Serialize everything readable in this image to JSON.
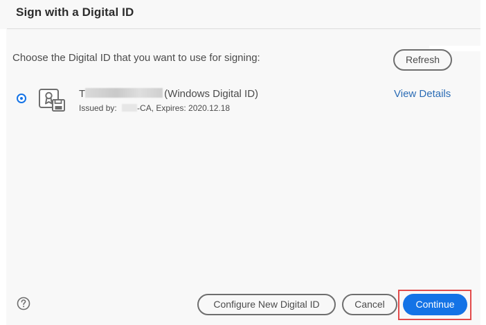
{
  "dialog": {
    "title": "Sign with a Digital ID",
    "prompt": "Choose the Digital ID that you want to use for signing:",
    "refresh_label": "Refresh"
  },
  "digital_ids": [
    {
      "selected": true,
      "name_visible_prefix": "T",
      "type_label": "(Windows Digital ID)",
      "issued_by_prefix": "Issued by: ",
      "issued_by_suffix": "-CA, Expires: 2020.12.18",
      "view_details_label": "View Details",
      "icon": "certificate-id-icon"
    }
  ],
  "footer": {
    "help_icon": "help-icon",
    "configure_label": "Configure New Digital ID",
    "cancel_label": "Cancel",
    "continue_label": "Continue"
  },
  "colors": {
    "accent": "#1473e6",
    "link": "#2b6cb5",
    "highlight": "#e24a4a",
    "text": "#4b4b4b"
  }
}
